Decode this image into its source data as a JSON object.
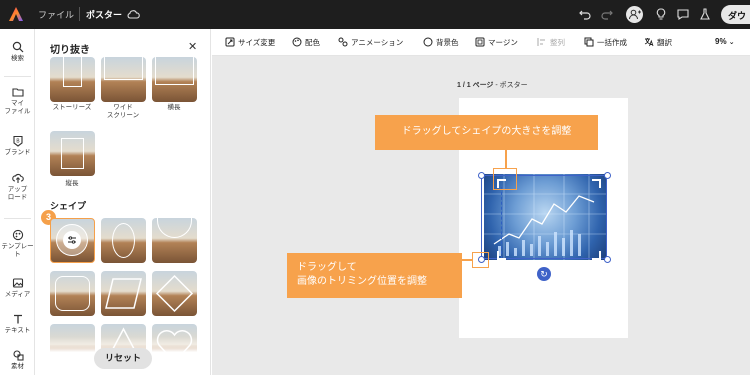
{
  "topbar": {
    "file_label": "ファイル",
    "doc_title": "ポスター",
    "download_label": "ダウ"
  },
  "rail": [
    {
      "label": "検索",
      "icon": "search-icon"
    },
    {
      "label": "マイ\nファイル",
      "icon": "folder-icon"
    },
    {
      "label": "ブランド",
      "icon": "brand-icon"
    },
    {
      "label": "アップ\nロード",
      "icon": "upload-icon"
    },
    {
      "label": "テンプレー\nト",
      "icon": "template-icon"
    },
    {
      "label": "メディア",
      "icon": "media-icon"
    },
    {
      "label": "テキスト",
      "icon": "text-icon"
    },
    {
      "label": "素材",
      "icon": "elements-icon"
    }
  ],
  "panel": {
    "title": "切り抜き",
    "thumbs_top": [
      {
        "label": "ストーリーズ"
      },
      {
        "label": "ワイド\nスクリーン"
      },
      {
        "label": "横長"
      },
      {
        "label": "縦長"
      }
    ],
    "section_shapes": "シェイプ",
    "step_badge": "3",
    "reset_label": "リセット"
  },
  "toolbar": {
    "resize": "サイズ変更",
    "color": "配色",
    "animation": "アニメーション",
    "background": "背景色",
    "margin": "マージン",
    "align": "整列",
    "batch": "一括作成",
    "translate": "翻訳",
    "zoom": "9%"
  },
  "canvas": {
    "page_count": "1 / 1 ページ",
    "page_name": "ポスター"
  },
  "callouts": {
    "resize_shape": "ドラッグしてシェイプの大きさを調整",
    "trim_line1": "ドラッグして",
    "trim_line2": "画像のトリミング位置を調整"
  },
  "colors": {
    "accent_orange": "#f7a24c",
    "selection_blue": "#3f62c8",
    "topbar_bg": "#1e1e1e"
  }
}
